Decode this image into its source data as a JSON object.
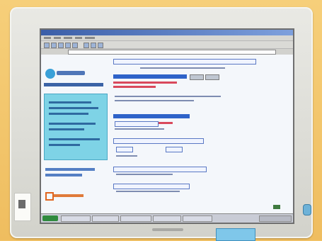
{
  "scene": {
    "description_type": "photo-of-crt-monitor-displaying-webpage",
    "colors": {
      "background": "#f3c56b",
      "bezel": "#e3e3de",
      "screen_blue": "#c8d9f0",
      "accent_blue": "#2f63c9",
      "accent_red": "#d9495c",
      "accent_orange": "#e0651f",
      "panel_cyan": "#7ed3e6"
    }
  }
}
